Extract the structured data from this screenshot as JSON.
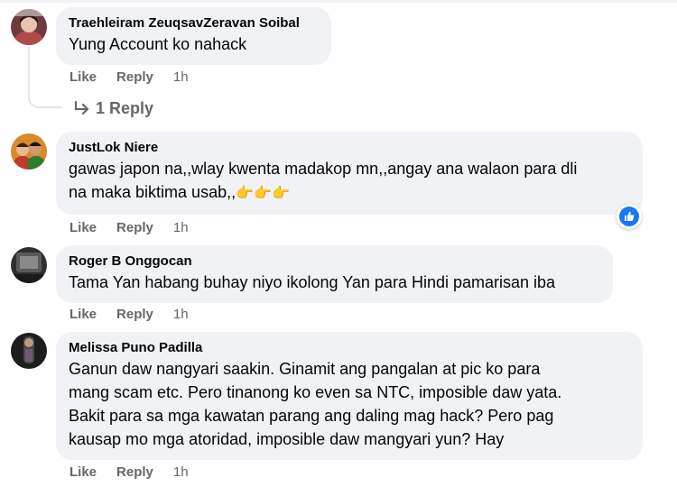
{
  "colors": {
    "bubble_bg": "#f0f2f5",
    "action_text": "#65676b",
    "name_text": "#050505",
    "like_blue": "#1877f2"
  },
  "comments": [
    {
      "author": "Traehleiram ZeuqsavZeravan Soibal",
      "text": "Yung Account ko nahack",
      "like_label": "Like",
      "reply_label": "Reply",
      "time": "1h",
      "replies_link": "1 Reply",
      "avatar_icon": "profile-photo"
    },
    {
      "author": "JustLok Niere",
      "text": "gawas japon na,,wlay kwenta madakop mn,,angay ana walaon para dli\nna maka biktima usab,,",
      "emoji": "👉👉👉",
      "like_label": "Like",
      "reply_label": "Reply",
      "time": "1h",
      "reaction_icon": "like-reaction-icon",
      "avatar_icon": "profile-photo"
    },
    {
      "author": "Roger B Onggocan",
      "text": "Tama Yan habang buhay niyo ikolong Yan para Hindi pamarisan iba",
      "like_label": "Like",
      "reply_label": "Reply",
      "time": "1h",
      "avatar_icon": "profile-photo"
    },
    {
      "author": "Melissa Puno Padilla",
      "text": "Ganun daw nangyari saakin. Ginamit ang pangalan at pic ko para\nmang scam etc. Pero tinanong ko even sa NTC, imposible daw yata.\nBakit para sa mga kawatan parang ang daling mag hack? Pero pag\nkausap mo mga atoridad, imposible daw mangyari yun? Hay",
      "like_label": "Like",
      "reply_label": "Reply",
      "time": "1h",
      "avatar_icon": "profile-photo"
    }
  ]
}
